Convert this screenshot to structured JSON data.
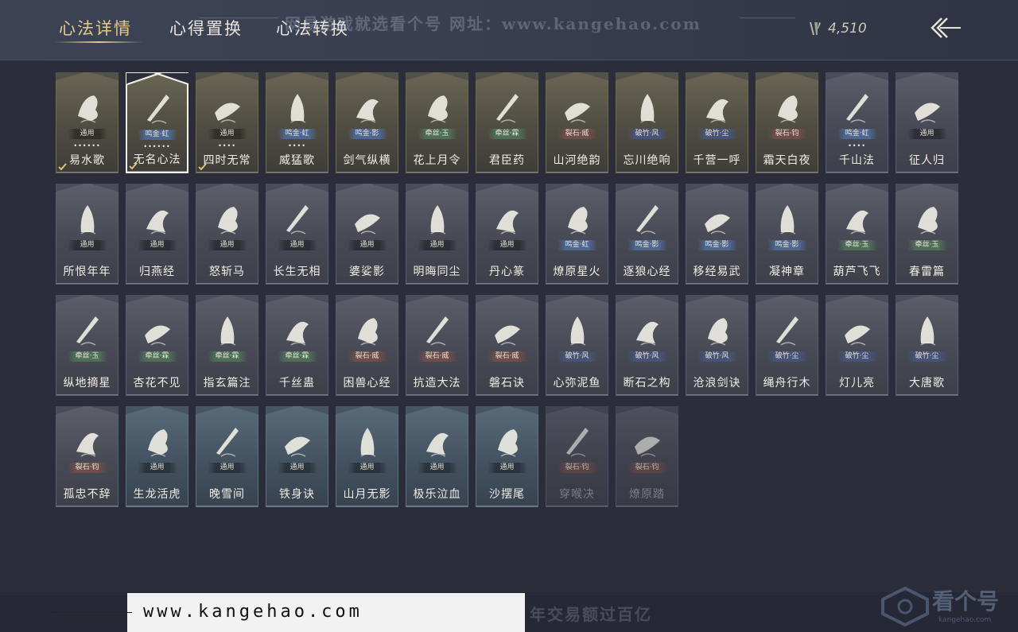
{
  "header": {
    "tabs": [
      {
        "label": "心法详情"
      },
      {
        "label": "心得置换"
      },
      {
        "label": "心法转换"
      }
    ],
    "watermark": "网易游戏就选看个号   网址：www.kangehao.com",
    "currency_value": "4,510",
    "currency_icon": "feather-currency-icon",
    "back_icon": "back-arrow-icon"
  },
  "cards": [
    {
      "name": "易水歌",
      "tag": "通用",
      "dots": "••••••",
      "style": "gold",
      "tagc": "",
      "check": true
    },
    {
      "name": "无名心法",
      "tag": "鸣金·虹",
      "dots": "••••••",
      "style": "gold",
      "tagc": "t-blue",
      "check": true,
      "selected": true
    },
    {
      "name": "四时无常",
      "tag": "通用",
      "dots": "••••",
      "style": "gold",
      "tagc": "",
      "check": true
    },
    {
      "name": "威猛歌",
      "tag": "鸣金·虹",
      "dots": "••••",
      "style": "gold",
      "tagc": "t-blue"
    },
    {
      "name": "剑气纵横",
      "tag": "鸣金·影",
      "style": "gold",
      "tagc": "t-blue"
    },
    {
      "name": "花上月令",
      "tag": "牵丝·玉",
      "style": "gold",
      "tagc": "t-green"
    },
    {
      "name": "君臣药",
      "tag": "牵丝·霖",
      "style": "gold",
      "tagc": "t-green"
    },
    {
      "name": "山河绝韵",
      "tag": "裂石·威",
      "style": "gold",
      "tagc": "t-red"
    },
    {
      "name": "忘川绝响",
      "tag": "破竹·风",
      "style": "gold",
      "tagc": "t-navy"
    },
    {
      "name": "千营一呼",
      "tag": "破竹·尘",
      "style": "gold",
      "tagc": "t-navy"
    },
    {
      "name": "霜天白夜",
      "tag": "裂石·钧",
      "style": "gold",
      "tagc": "t-red"
    },
    {
      "name": "千山法",
      "tag": "鸣金·虹",
      "dots": "••••",
      "style": "grey",
      "tagc": "t-blue"
    },
    {
      "name": "征人归",
      "tag": "通用",
      "style": "grey",
      "tagc": ""
    },
    {
      "name": "所恨年年",
      "tag": "通用",
      "style": "grey",
      "tagc": ""
    },
    {
      "name": "归燕经",
      "tag": "通用",
      "style": "grey",
      "tagc": ""
    },
    {
      "name": "怒斩马",
      "tag": "通用",
      "style": "grey",
      "tagc": ""
    },
    {
      "name": "长生无相",
      "tag": "通用",
      "style": "grey",
      "tagc": ""
    },
    {
      "name": "婆娑影",
      "tag": "通用",
      "style": "grey",
      "tagc": ""
    },
    {
      "name": "明晦同尘",
      "tag": "通用",
      "style": "grey",
      "tagc": ""
    },
    {
      "name": "丹心篆",
      "tag": "通用",
      "style": "grey",
      "tagc": ""
    },
    {
      "name": "燎原星火",
      "tag": "鸣金·虹",
      "style": "grey",
      "tagc": "t-blue"
    },
    {
      "name": "逐狼心经",
      "tag": "鸣金·影",
      "style": "grey",
      "tagc": "t-blue"
    },
    {
      "name": "移经易武",
      "tag": "鸣金·影",
      "style": "grey",
      "tagc": "t-blue"
    },
    {
      "name": "凝神章",
      "tag": "鸣金·影",
      "style": "grey",
      "tagc": "t-blue"
    },
    {
      "name": "葫芦飞飞",
      "tag": "牵丝·玉",
      "style": "grey",
      "tagc": "t-green"
    },
    {
      "name": "春雷篇",
      "tag": "牵丝·玉",
      "style": "grey",
      "tagc": "t-green"
    },
    {
      "name": "纵地摘星",
      "tag": "牵丝·玉",
      "style": "grey",
      "tagc": "t-green"
    },
    {
      "name": "杏花不见",
      "tag": "牵丝·霖",
      "style": "grey",
      "tagc": "t-green"
    },
    {
      "name": "指玄篇注",
      "tag": "牵丝·霖",
      "style": "grey",
      "tagc": "t-green"
    },
    {
      "name": "千丝蛊",
      "tag": "牵丝·霖",
      "style": "grey",
      "tagc": "t-green"
    },
    {
      "name": "困兽心经",
      "tag": "裂石·威",
      "style": "grey",
      "tagc": "t-red"
    },
    {
      "name": "抗造大法",
      "tag": "裂石·威",
      "style": "grey",
      "tagc": "t-red"
    },
    {
      "name": "磐石诀",
      "tag": "裂石·威",
      "style": "grey",
      "tagc": "t-red"
    },
    {
      "name": "心弥泥鱼",
      "tag": "破竹·风",
      "style": "grey",
      "tagc": "t-navy"
    },
    {
      "name": "断石之构",
      "tag": "破竹·风",
      "style": "grey",
      "tagc": "t-navy"
    },
    {
      "name": "沧浪剑诀",
      "tag": "破竹·风",
      "style": "grey",
      "tagc": "t-navy"
    },
    {
      "name": "绳舟行木",
      "tag": "破竹·尘",
      "style": "grey",
      "tagc": "t-navy"
    },
    {
      "name": "灯儿亮",
      "tag": "破竹·尘",
      "style": "grey",
      "tagc": "t-navy"
    },
    {
      "name": "大唐歌",
      "tag": "破竹·尘",
      "style": "grey",
      "tagc": "t-navy"
    },
    {
      "name": "孤忠不辞",
      "tag": "裂石·钧",
      "style": "grey",
      "tagc": "t-red"
    },
    {
      "name": "生龙活虎",
      "tag": "通用",
      "style": "blue",
      "tagc": ""
    },
    {
      "name": "晚雪间",
      "tag": "通用",
      "style": "blue",
      "tagc": ""
    },
    {
      "name": "铁身诀",
      "tag": "通用",
      "style": "blue",
      "tagc": ""
    },
    {
      "name": "山月无影",
      "tag": "通用",
      "style": "blue",
      "tagc": ""
    },
    {
      "name": "极乐泣血",
      "tag": "通用",
      "style": "blue",
      "tagc": ""
    },
    {
      "name": "沙摆尾",
      "tag": "通用",
      "style": "blue",
      "tagc": ""
    },
    {
      "name": "穿喉决",
      "tag": "裂石·钧",
      "style": "grey dim",
      "tagc": "t-red"
    },
    {
      "name": "燎原踏",
      "tag": "裂石·钧",
      "style": "grey dim",
      "tagc": "t-red"
    }
  ],
  "footer": {
    "watermark": "看个号专业网易游戏八年  年交易额过百亿",
    "url": "www.kangehao.com",
    "logo_text": "看个号",
    "logo_sub": "kangehao.com"
  }
}
